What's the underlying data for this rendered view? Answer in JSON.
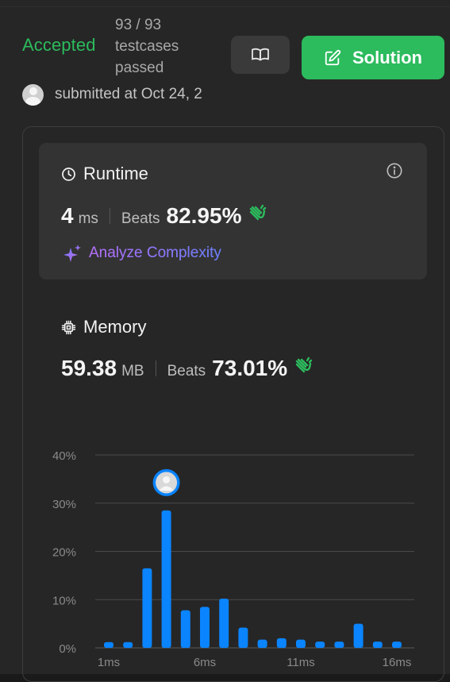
{
  "header": {
    "status": "Accepted",
    "testcases_line1": "93 / 93",
    "testcases_line2": "testcases",
    "testcases_line3": "passed",
    "solution_label": "Solution",
    "submitted_text": "submitted at Oct 24, 2"
  },
  "runtime": {
    "title": "Runtime",
    "value": "4",
    "unit": "ms",
    "beats_label": "Beats",
    "beats_value": "82.95%",
    "analyze_label": "Analyze Complexity"
  },
  "memory": {
    "title": "Memory",
    "value": "59.38",
    "unit": "MB",
    "beats_label": "Beats",
    "beats_value": "73.01%"
  },
  "colors": {
    "accepted": "#2cbb5d",
    "bar": "#0a84ff",
    "clap": "#2cbb5d"
  },
  "icons": {
    "book": "book-open-icon",
    "solution": "edit-icon",
    "runtime": "clock-icon",
    "memory": "chip-icon",
    "info": "info-icon",
    "analyze": "sparkle-icon",
    "beats": "clap-icon"
  },
  "chart_data": {
    "type": "bar",
    "x": [
      1,
      2,
      3,
      4,
      5,
      6,
      7,
      8,
      9,
      10,
      11,
      12,
      13,
      14,
      15,
      16
    ],
    "values": [
      1.2,
      1.2,
      16.5,
      28.5,
      7.8,
      8.5,
      10.2,
      4.2,
      1.7,
      2.0,
      1.7,
      1.3,
      1.3,
      5.0,
      1.3,
      1.3
    ],
    "x_tick_labels": [
      "1ms",
      "6ms",
      "11ms",
      "16ms"
    ],
    "x_tick_values": [
      1,
      6,
      11,
      16
    ],
    "y_tick_labels": [
      "0%",
      "10%",
      "20%",
      "30%",
      "40%"
    ],
    "y_tick_values": [
      0,
      10,
      20,
      30,
      40
    ],
    "ylim": [
      0,
      40
    ],
    "highlight_x": 4,
    "grid": true
  }
}
